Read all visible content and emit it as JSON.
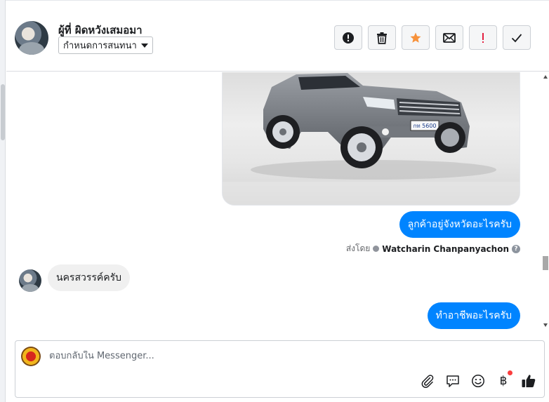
{
  "header": {
    "contact_name": "ผู้ที่ ผิดหวังเสมอมา",
    "assign_label": "กำหนดการสนทนา",
    "actions": [
      {
        "name": "mark-spam-button",
        "icon": "exclamation-circle-icon"
      },
      {
        "name": "delete-button",
        "icon": "trash-icon"
      },
      {
        "name": "star-button",
        "icon": "star-icon",
        "color": "#f7923b"
      },
      {
        "name": "mark-unread-button",
        "icon": "envelope-icon"
      },
      {
        "name": "flag-important-button",
        "icon": "exclamation-mark-icon",
        "color": "#e41e3f"
      },
      {
        "name": "mark-done-button",
        "icon": "checkmark-icon"
      }
    ]
  },
  "messages": [
    {
      "type": "image",
      "direction": "outgoing",
      "alt": "car-photo",
      "plate_text": "กท 5600"
    },
    {
      "type": "text",
      "direction": "outgoing",
      "text": "ลูกค้าอยู่จังหวัดอะไรครับ"
    },
    {
      "type": "sent_by",
      "prefix": "ส่งโดย",
      "name": "Watcharin Chanpanyachon",
      "help_icon": "?"
    },
    {
      "type": "text",
      "direction": "incoming",
      "text": "นครสวรรค์ครับ"
    },
    {
      "type": "text",
      "direction": "outgoing",
      "text": "ทำอาชีพอะไรครับ"
    }
  ],
  "composer": {
    "placeholder": "ตอบกลับใน Messenger...",
    "tools": [
      "paperclip-icon",
      "saved-reply-icon",
      "emoji-icon",
      "baht-payment-icon",
      "like-icon"
    ],
    "baht_symbol": "฿"
  },
  "colors": {
    "outgoing_bubble": "#0084ff",
    "incoming_bubble": "#f0f0f0",
    "star": "#f7923b",
    "alert": "#e41e3f"
  }
}
